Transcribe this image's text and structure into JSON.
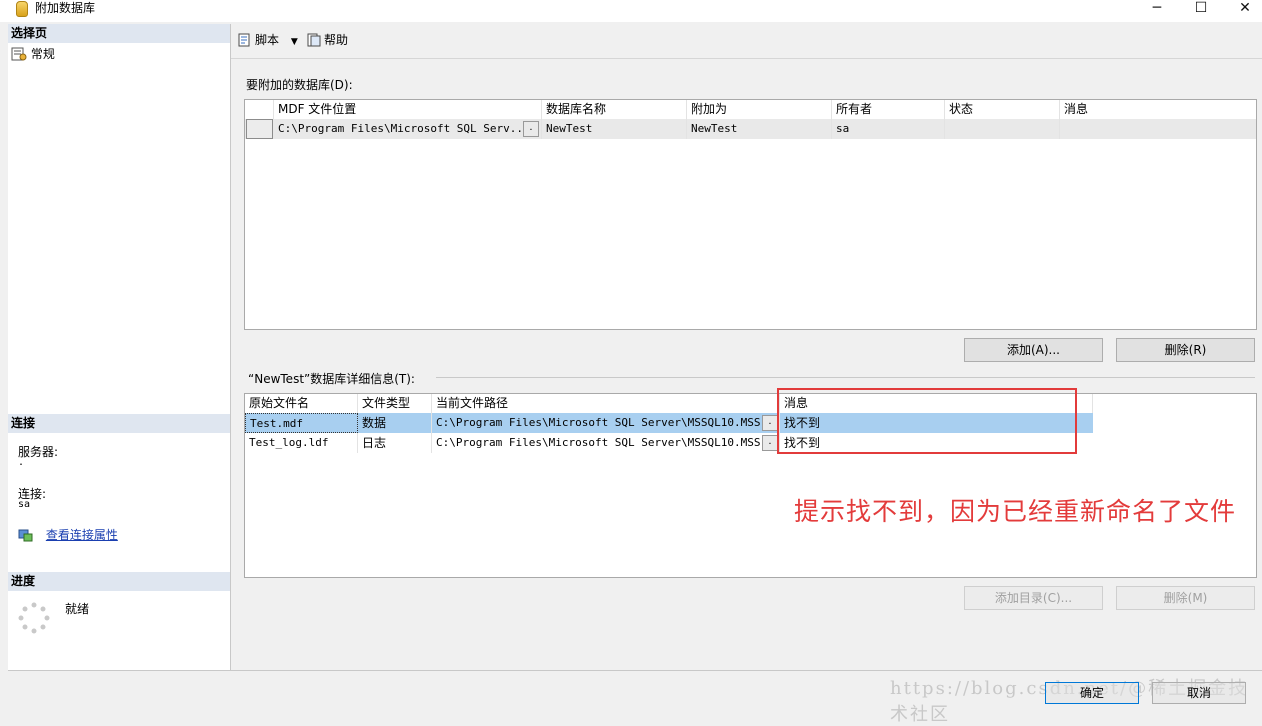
{
  "window": {
    "title": "附加数据库",
    "controls": [
      "─",
      "☐",
      "✕"
    ]
  },
  "left_pane": {
    "select_page_header": "选择页",
    "pages": [
      {
        "label": "常规",
        "icon": "page-settings-icon"
      }
    ],
    "connection_header": "连接",
    "server_label": "服务器:",
    "server_value": ".",
    "connection_label": "连接:",
    "connection_value": "sa",
    "view_connection_link": "查看连接属性",
    "progress_header": "进度",
    "progress_status": "就绪"
  },
  "toolbar": {
    "script_label": "脚本",
    "help_label": "帮助"
  },
  "databases_section": {
    "label": "要附加的数据库(D):",
    "columns": [
      "MDF 文件位置",
      "数据库名称",
      "附加为",
      "所有者",
      "状态",
      "消息"
    ],
    "rows": [
      {
        "mdf": "C:\\Program Files\\Microsoft SQL Serv...",
        "ellipsis": ".",
        "db_name": "NewTest",
        "attach_as": "NewTest",
        "owner": "sa",
        "status": "",
        "message": ""
      }
    ],
    "add_button": "添加(A)...",
    "remove_button": "删除(R)"
  },
  "details_section": {
    "label": "“NewTest”数据库详细信息(T):",
    "columns": [
      "原始文件名",
      "文件类型",
      "当前文件路径",
      "消息"
    ],
    "rows": [
      {
        "file": "Test.mdf",
        "type": "数据",
        "path": "C:\\Program Files\\Microsoft SQL Server\\MSSQL10.MSS...",
        "ellipsis": ".",
        "message": "找不到"
      },
      {
        "file": "Test_log.ldf",
        "type": "日志",
        "path": "C:\\Program Files\\Microsoft SQL Server\\MSSQL10.MSS...",
        "ellipsis": ".",
        "message": "找不到"
      }
    ],
    "add_catalog_button": "添加目录(C)...",
    "remove_button": "删除(M)"
  },
  "annotation": "提示找不到，因为已经重新命名了文件",
  "footer": {
    "ok_button": "确定",
    "cancel_button": "取消",
    "watermark": "https://blog.csdn.net/@稀土掘金技术社区"
  },
  "colors": {
    "selected_row": "#a8cff0",
    "annotation_red": "#e33b3b",
    "link_blue": "#1a3fb0"
  }
}
